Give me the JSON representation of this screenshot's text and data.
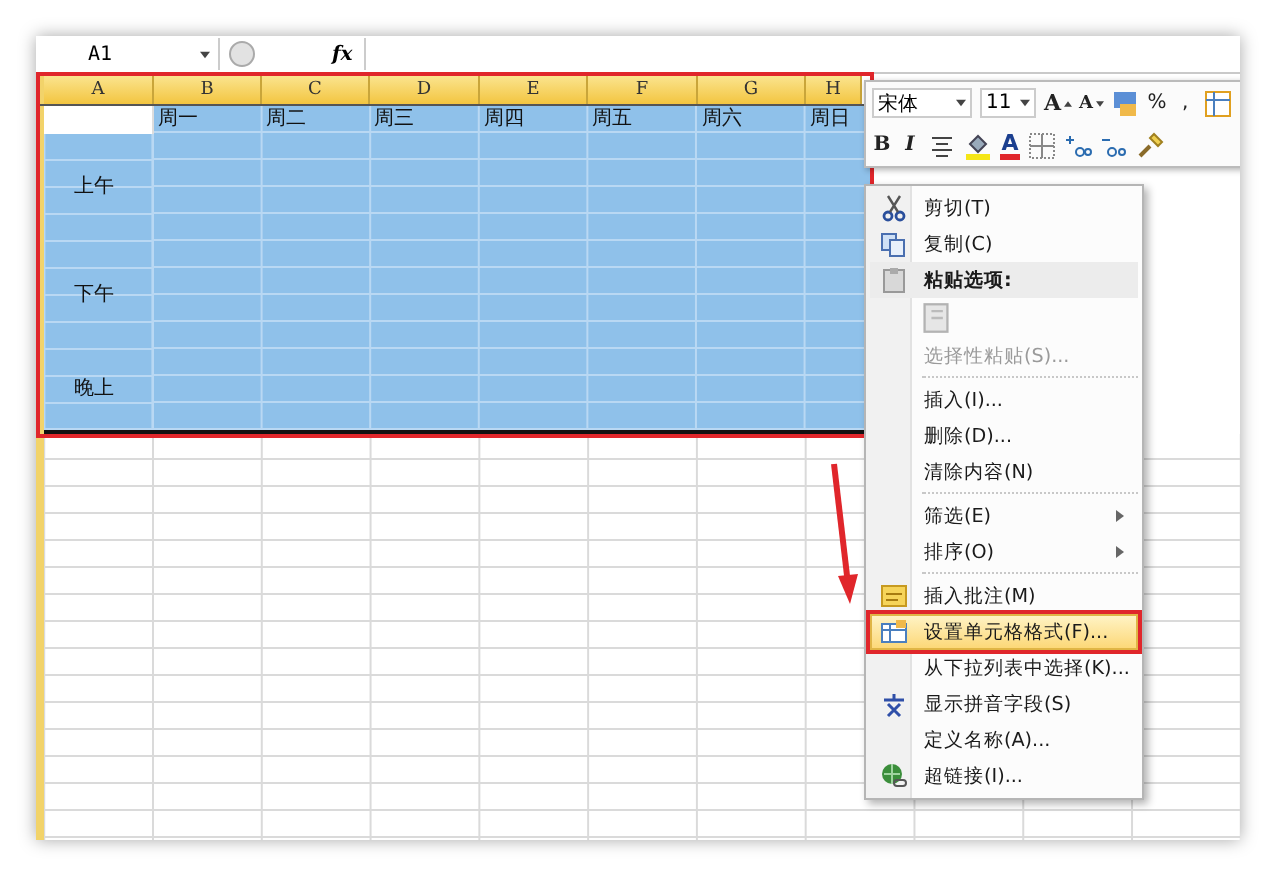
{
  "formula_bar": {
    "name_box": "A1",
    "fx": "fx"
  },
  "columns": [
    "A",
    "B",
    "C",
    "D",
    "E",
    "F",
    "G",
    "H"
  ],
  "table": {
    "selected": true,
    "header": [
      "周一",
      "周二",
      "周三",
      "周四",
      "周五",
      "周六",
      "周日"
    ],
    "groups": [
      {
        "label": "上午"
      },
      {
        "label": "下午"
      },
      {
        "label": "晚上"
      }
    ]
  },
  "mini_toolbar": {
    "top_row": [
      {
        "kind": "font",
        "value": "宋体"
      },
      {
        "kind": "size",
        "value": "11"
      },
      {
        "kind": "grow",
        "text": "A"
      },
      {
        "kind": "shrink",
        "text": "A"
      },
      {
        "kind": "styles"
      },
      {
        "kind": "char",
        "text": "%"
      },
      {
        "kind": "char",
        "text": ","
      },
      {
        "kind": "table"
      }
    ],
    "bottom_row": [
      {
        "kind": "bold",
        "text": "B"
      },
      {
        "kind": "italic",
        "text": "I"
      },
      {
        "kind": "align"
      },
      {
        "kind": "fill"
      },
      {
        "kind": "fontcolor",
        "text": "A"
      },
      {
        "kind": "border"
      },
      {
        "kind": "incdec"
      },
      {
        "kind": "decdec"
      },
      {
        "kind": "painter"
      }
    ]
  },
  "context_menu": [
    {
      "kind": "item",
      "label": "剪切(T)",
      "disabled": false,
      "selected": false
    },
    {
      "kind": "item",
      "label": "复制(C)",
      "disabled": false,
      "selected": false
    },
    {
      "kind": "header",
      "label": "粘贴选项:"
    },
    {
      "kind": "paste"
    },
    {
      "kind": "item",
      "label": "选择性粘贴(S)...",
      "disabled": true,
      "selected": false
    },
    {
      "kind": "separator"
    },
    {
      "kind": "item",
      "label": "插入(I)...",
      "disabled": false,
      "selected": false
    },
    {
      "kind": "item",
      "label": "删除(D)...",
      "disabled": false,
      "selected": false
    },
    {
      "kind": "item",
      "label": "清除内容(N)",
      "disabled": false,
      "selected": false
    },
    {
      "kind": "separator"
    },
    {
      "kind": "submenu",
      "label": "筛选(E)",
      "disabled": false,
      "selected": false
    },
    {
      "kind": "submenu",
      "label": "排序(O)",
      "disabled": false,
      "selected": false
    },
    {
      "kind": "separator"
    },
    {
      "kind": "item",
      "label": "插入批注(M)",
      "disabled": false,
      "selected": false
    },
    {
      "kind": "item",
      "label": "设置单元格格式(F)...",
      "disabled": false,
      "selected": true
    },
    {
      "kind": "item",
      "label": "从下拉列表中选择(K)...",
      "disabled": false,
      "selected": false
    },
    {
      "kind": "item",
      "label": "显示拼音字段(S)",
      "disabled": false,
      "selected": false
    },
    {
      "kind": "item",
      "label": "定义名称(A)...",
      "disabled": false,
      "selected": false
    },
    {
      "kind": "item",
      "label": "超链接(I)...",
      "disabled": false,
      "selected": false
    }
  ]
}
